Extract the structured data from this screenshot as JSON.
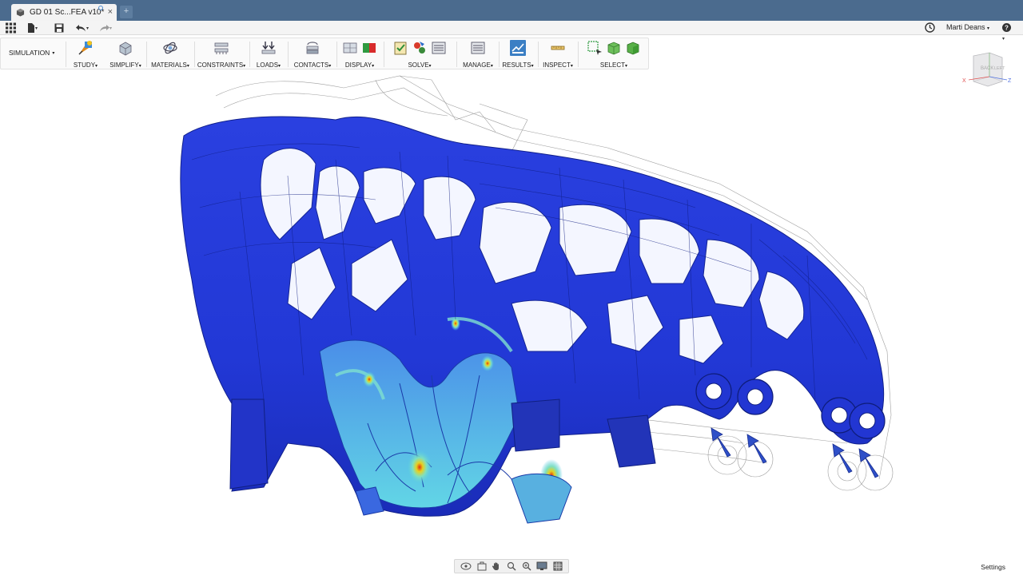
{
  "window": {
    "tab_title": "GD 01 Sc...FEA v10*",
    "close_glyph": "×",
    "new_tab_glyph": "+"
  },
  "quickbar": {
    "user_name": "Marti Deans",
    "help_glyph": "?",
    "caret": "▾"
  },
  "ribbon": {
    "workspace": "SIMULATION",
    "groups": [
      {
        "label": "STUDY"
      },
      {
        "label": "SIMPLIFY"
      },
      {
        "label": "MATERIALS"
      },
      {
        "label": "CONSTRAINTS"
      },
      {
        "label": "LOADS"
      },
      {
        "label": "CONTACTS"
      },
      {
        "label": "DISPLAY"
      },
      {
        "label": "SOLVE"
      },
      {
        "label": "MANAGE"
      },
      {
        "label": "RESULTS"
      },
      {
        "label": "INSPECT"
      },
      {
        "label": "SELECT"
      }
    ],
    "caret": "▾"
  },
  "viewcube": {
    "back_label": "BACK",
    "left_label": "LEFT",
    "axis_x": "X",
    "axis_z": "Z"
  },
  "navbar": {
    "icons": [
      "orbit-icon",
      "look-at-icon",
      "pan-icon",
      "zoom-icon",
      "zoom-window-icon",
      "display-settings-icon",
      "grid-icon"
    ]
  },
  "settings_label": "Settings",
  "colors": {
    "titlebar": "#4b6b8e",
    "stress_low": "#1f2fd6",
    "stress_mid": "#55c8e8",
    "stress_high": "#e8d020",
    "stress_peak": "#e03010",
    "load_arrow": "#2e4fc8"
  }
}
